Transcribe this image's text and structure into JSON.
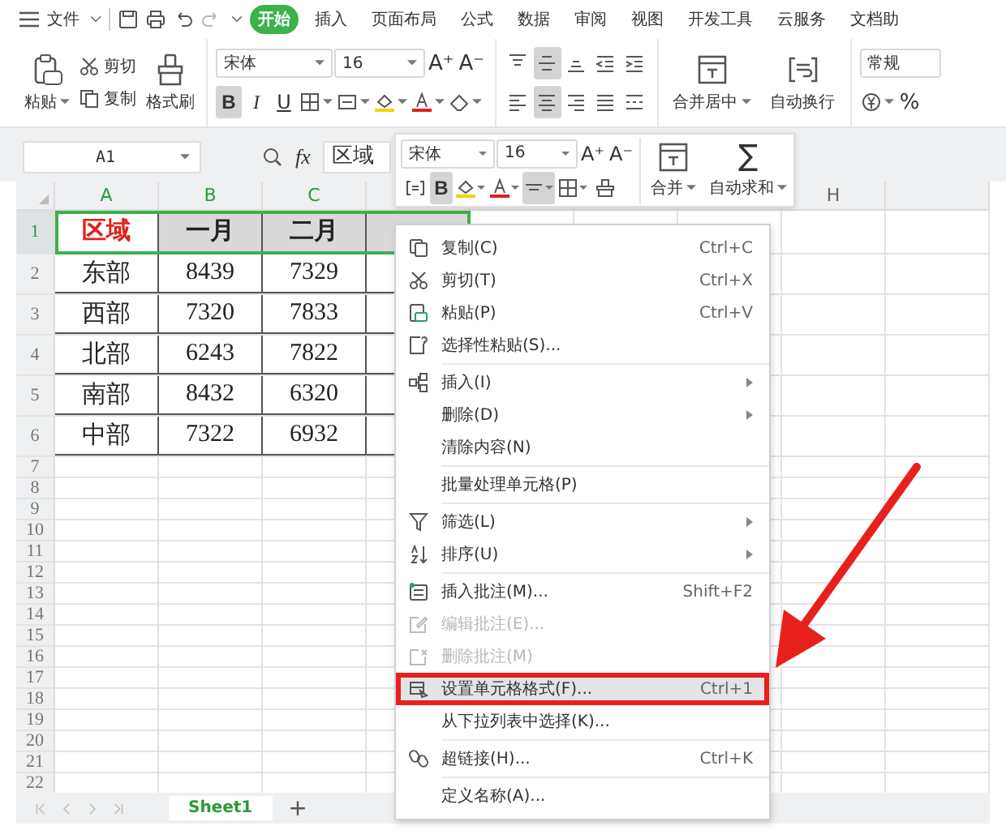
{
  "menu_bar": {
    "file_menu": "文件",
    "tabs": [
      {
        "label": "开始",
        "selected": true
      },
      {
        "label": "插入",
        "selected": false
      },
      {
        "label": "页面布局",
        "selected": false
      },
      {
        "label": "公式",
        "selected": false
      },
      {
        "label": "数据",
        "selected": false
      },
      {
        "label": "审阅",
        "selected": false
      },
      {
        "label": "视图",
        "selected": false
      },
      {
        "label": "开发工具",
        "selected": false
      },
      {
        "label": "云服务",
        "selected": false
      },
      {
        "label": "文档助",
        "selected": false
      }
    ]
  },
  "ribbon": {
    "paste": "粘贴",
    "cut": "剪切",
    "copy": "复制",
    "format_painter": "格式刷",
    "font_name": "宋体",
    "font_size": "16",
    "grow_font": "A⁺",
    "shrink_font": "A⁻",
    "bold": {
      "label": "B",
      "selected": true
    },
    "italic": {
      "label": "I",
      "selected": false
    },
    "underline": {
      "label": "U",
      "selected": false
    },
    "vertical_align": [
      {
        "selected": false
      },
      {
        "selected": true
      },
      {
        "selected": false
      }
    ],
    "horizontal_align": [
      {
        "selected": false
      },
      {
        "selected": true
      },
      {
        "selected": false
      },
      {
        "selected": false
      },
      {
        "selected": false
      }
    ],
    "merge_center": "合并居中",
    "wrap_text": "自动换行",
    "number_format": "常规",
    "percent": "%"
  },
  "formula_bar": {
    "cell_ref": "A1",
    "fx": "fx",
    "value": "区域"
  },
  "mini_toolbar": {
    "font_name": "宋体",
    "font_size": "16",
    "grow_font": "A⁺",
    "shrink_font": "A⁻",
    "bold": {
      "label": "B",
      "selected": true
    },
    "align": {
      "selected": true
    },
    "merge": "合并",
    "sigma": "∑",
    "autosum": "自动求和"
  },
  "column_headers": [
    "A",
    "B",
    "C"
  ],
  "far_column_header": "H",
  "row_numbers": [
    "1",
    "2",
    "3",
    "4",
    "5",
    "6",
    "7",
    "8",
    "9",
    "10",
    "11",
    "12",
    "13",
    "14",
    "15",
    "16",
    "17",
    "18",
    "19",
    "20",
    "21",
    "22"
  ],
  "table": {
    "header": [
      {
        "text": "区域",
        "color": "#e0201b",
        "active": true,
        "selected": true
      },
      {
        "text": "一月",
        "color": "#222222",
        "active": false,
        "selected": true
      },
      {
        "text": "二月",
        "color": "#222222",
        "active": false,
        "selected": true
      }
    ],
    "rows": [
      [
        "东部",
        "8439",
        "7329"
      ],
      [
        "西部",
        "7320",
        "7833"
      ],
      [
        "北部",
        "6243",
        "7822"
      ],
      [
        "南部",
        "8432",
        "6320"
      ],
      [
        "中部",
        "7322",
        "6932"
      ]
    ]
  },
  "context_menu": {
    "items": [
      {
        "kind": "item",
        "label": "复制(C)",
        "shortcut": "Ctrl+C",
        "submenu": false,
        "disabled": false,
        "selected": false
      },
      {
        "kind": "item",
        "label": "剪切(T)",
        "shortcut": "Ctrl+X",
        "submenu": false,
        "disabled": false,
        "selected": false
      },
      {
        "kind": "item",
        "label": "粘贴(P)",
        "shortcut": "Ctrl+V",
        "submenu": false,
        "disabled": false,
        "selected": false
      },
      {
        "kind": "item",
        "label": "选择性粘贴(S)...",
        "submenu": false,
        "disabled": false,
        "selected": false
      },
      {
        "kind": "separator"
      },
      {
        "kind": "item",
        "label": "插入(I)",
        "submenu": true,
        "disabled": false,
        "selected": false
      },
      {
        "kind": "item",
        "label": "删除(D)",
        "submenu": true,
        "disabled": false,
        "selected": false
      },
      {
        "kind": "item",
        "label": "清除内容(N)",
        "submenu": false,
        "disabled": false,
        "selected": false
      },
      {
        "kind": "separator"
      },
      {
        "kind": "item",
        "label": "批量处理单元格(P)",
        "submenu": false,
        "disabled": false,
        "selected": false
      },
      {
        "kind": "separator"
      },
      {
        "kind": "item",
        "label": "筛选(L)",
        "submenu": true,
        "disabled": false,
        "selected": false
      },
      {
        "kind": "item",
        "label": "排序(U)",
        "submenu": true,
        "disabled": false,
        "selected": false
      },
      {
        "kind": "separator"
      },
      {
        "kind": "item",
        "label": "插入批注(M)...",
        "shortcut": "Shift+F2",
        "submenu": false,
        "disabled": false,
        "selected": false
      },
      {
        "kind": "item",
        "label": "编辑批注(E)...",
        "submenu": false,
        "disabled": true,
        "selected": false
      },
      {
        "kind": "item",
        "label": "删除批注(M)",
        "submenu": false,
        "disabled": true,
        "selected": false
      },
      {
        "kind": "item",
        "label": "设置单元格格式(F)...",
        "shortcut": "Ctrl+1",
        "submenu": false,
        "disabled": false,
        "selected": true
      },
      {
        "kind": "item",
        "label": "从下拉列表中选择(K)...",
        "submenu": false,
        "disabled": false,
        "selected": false
      },
      {
        "kind": "separator"
      },
      {
        "kind": "item",
        "label": "超链接(H)...",
        "shortcut": "Ctrl+K",
        "submenu": false,
        "disabled": false,
        "selected": false
      },
      {
        "kind": "separator"
      },
      {
        "kind": "item",
        "label": "定义名称(A)...",
        "submenu": false,
        "disabled": false,
        "selected": false
      }
    ]
  },
  "sheet_tabs": [
    {
      "label": "Sheet1",
      "selected": true
    }
  ],
  "add_sheet": "+"
}
